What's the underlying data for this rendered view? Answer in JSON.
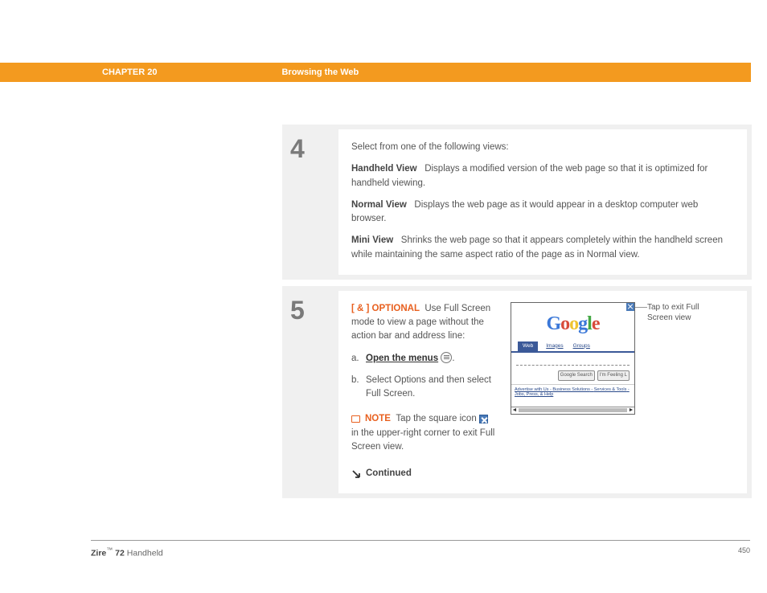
{
  "header": {
    "chapter": "CHAPTER 20",
    "title": "Browsing the Web"
  },
  "step4": {
    "num": "4",
    "intro": "Select from one of the following views:",
    "views": [
      {
        "name": "Handheld View",
        "desc": "Displays a modified version of the web page so that it is optimized for handheld viewing."
      },
      {
        "name": "Normal View",
        "desc": "Displays the web page as it would appear in a desktop computer web browser."
      },
      {
        "name": "Mini View",
        "desc": "Shrinks the web page so that it appears completely within the handheld screen while maintaining the same aspect ratio of the page as in Normal view."
      }
    ]
  },
  "step5": {
    "num": "5",
    "optional_tag": "[ & ]  OPTIONAL",
    "optional_desc": "Use Full Screen mode to view a page without the action bar and address line:",
    "sub_a_key": "a.",
    "sub_a_text": "Open the menus",
    "sub_a_suffix": ".",
    "sub_b_key": "b.",
    "sub_b_text": "Select Options and then select Full Screen.",
    "note_label": "NOTE",
    "note_pre": "Tap the square icon",
    "note_post": "in the upper-right corner to exit Full Screen view.",
    "continued": "Continued",
    "callout": "Tap to exit Full Screen view",
    "handheld": {
      "logo": {
        "l1": "G",
        "l2": "o",
        "l3": "o",
        "l4": "g",
        "l5": "l",
        "l6": "e"
      },
      "tab_web": "Web",
      "tab_images": "Images",
      "tab_groups": "Groups",
      "btn_search": "Google Search",
      "btn_lucky": "I'm Feeling L",
      "links1": "Advertise with Us",
      "links2": "Business Solutions",
      "links3": "Services & Tools",
      "links4": "Jobs, Press, & Help"
    }
  },
  "footer": {
    "product_bold": "Zire",
    "tm": "™",
    "product_rest": " 72",
    "product_suffix": " Handheld",
    "page": "450"
  }
}
